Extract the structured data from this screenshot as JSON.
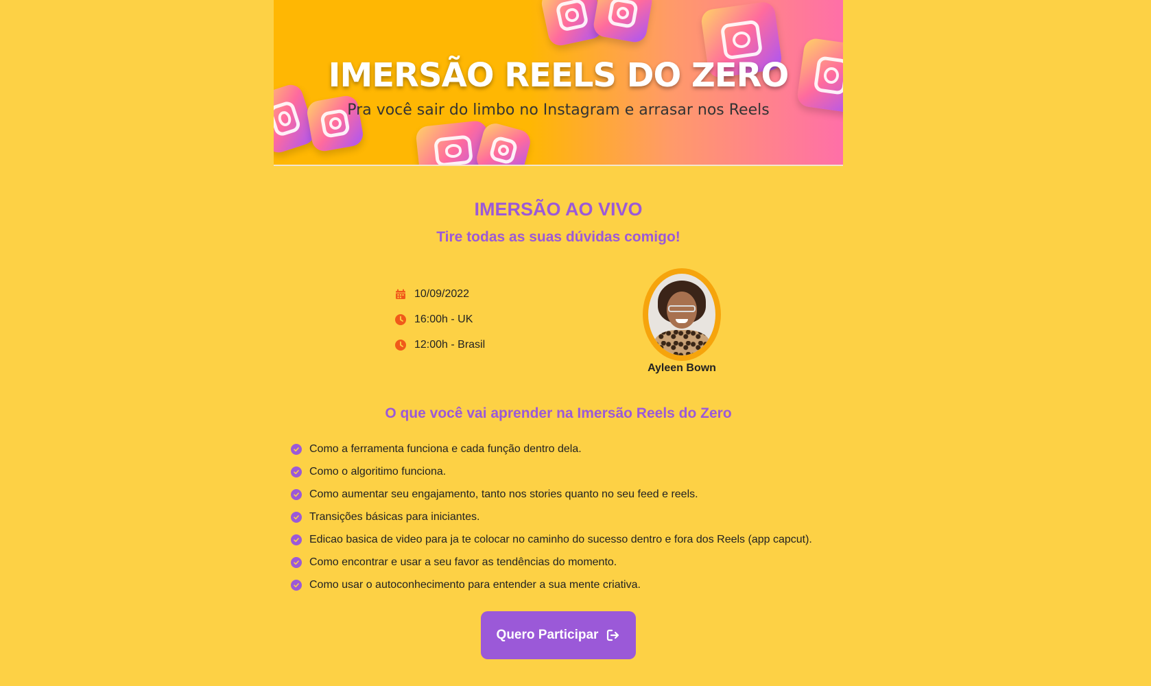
{
  "banner": {
    "title": "IMERSÃO REELS DO ZERO",
    "subtitle": "Pra você sair do limbo no Instagram e arrasar nos Reels"
  },
  "event": {
    "heading": "IMERSÃO AO VIVO",
    "subheading": "Tire todas as suas dúvidas comigo!",
    "date": "10/09/2022",
    "time_uk": "16:00h - UK",
    "time_brasil": "12:00h - Brasil",
    "icons": [
      "calendar-icon",
      "clock-icon",
      "clock-icon"
    ]
  },
  "speaker": {
    "name": "Ayleen Bown"
  },
  "learn": {
    "title": "O que você vai aprender na Imersão Reels do Zero",
    "items": [
      "Como a ferramenta funciona e cada função dentro dela.",
      "Como o algoritimo funciona.",
      "Como aumentar seu engajamento, tanto nos stories quanto no seu feed e reels.",
      "Transições básicas para iniciantes.",
      "Edicao basica de video para ja te colocar no caminho do sucesso dentro e fora dos Reels (app capcut).",
      "Como encontrar e usar a seu favor as tendências do momento.",
      "Como usar o autoconhecimento para entender a sua mente criativa."
    ]
  },
  "cta": {
    "label": "Quero Participar",
    "icon": "sign-out-icon"
  },
  "colors": {
    "background": "#fdd145",
    "accent": "#9b59d8",
    "icon_orange": "#f05a1a",
    "avatar_ring": "#f6a40c"
  }
}
